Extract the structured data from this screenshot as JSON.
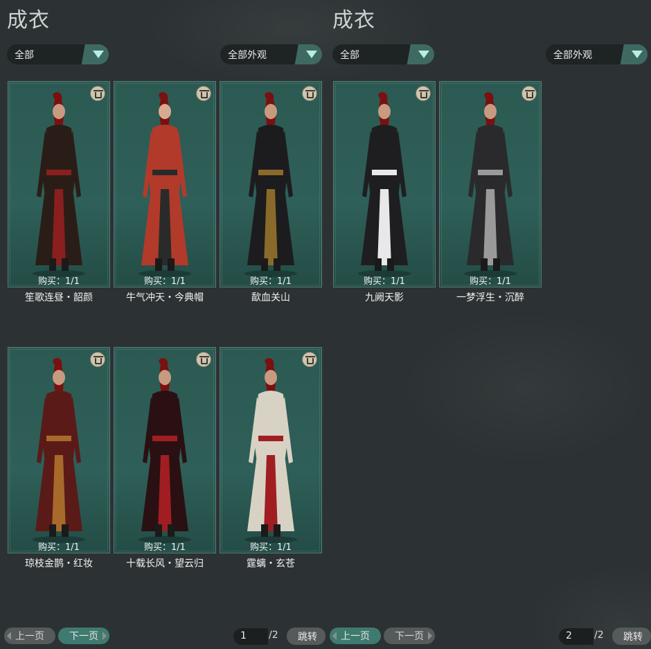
{
  "left": {
    "title": "成衣",
    "filter_category": "全部",
    "filter_appearance": "全部外观",
    "cards": [
      {
        "name": "笙歌连昼・韶颜",
        "count": "购买：1/1",
        "palette": {
          "coat": "#2a1d17",
          "trim": "#8a1f1f",
          "skin": "#c89a80"
        }
      },
      {
        "name": "牛气冲天・今典帽",
        "count": "购买：1/1",
        "palette": {
          "coat": "#b23a2a",
          "trim": "#2a2a2a",
          "skin": "#d8ab90"
        }
      },
      {
        "name": "歃血关山",
        "count": "购买：1/1",
        "palette": {
          "coat": "#1c1c1e",
          "trim": "#8a6a2a",
          "skin": "#c89a80"
        }
      },
      {
        "name": "琼枝金鹊・红妆",
        "count": "购买：1/1",
        "palette": {
          "coat": "#5a1a18",
          "trim": "#a86a2a",
          "skin": "#c89a80"
        }
      },
      {
        "name": "十载长风・望云归",
        "count": "购买：1/1",
        "palette": {
          "coat": "#2a1012",
          "trim": "#a01e22",
          "skin": "#c89a80"
        }
      },
      {
        "name": "霆螭・玄苍",
        "count": "购买：1/1",
        "palette": {
          "coat": "#d8d2c4",
          "trim": "#a01e22",
          "skin": "#c89a80"
        }
      }
    ],
    "pagination": {
      "prev": "上一页",
      "next": "下一页",
      "page": "1",
      "total": "/2",
      "jump": "跳转"
    }
  },
  "right": {
    "title": "成衣",
    "filter_category": "全部",
    "filter_appearance": "全部外观",
    "cards": [
      {
        "name": "九阙天影",
        "count": "购买：1/1",
        "palette": {
          "coat": "#1e1e20",
          "trim": "#e8e8e8",
          "skin": "#c89a80"
        }
      },
      {
        "name": "一梦浮生・沉醉",
        "count": "购买：1/1",
        "palette": {
          "coat": "#2a2a2c",
          "trim": "#9a9a9a",
          "skin": "#c89a80"
        }
      }
    ],
    "pagination": {
      "prev": "上一页",
      "next": "下一页",
      "page": "2",
      "total": "/2",
      "jump": "跳转"
    }
  }
}
